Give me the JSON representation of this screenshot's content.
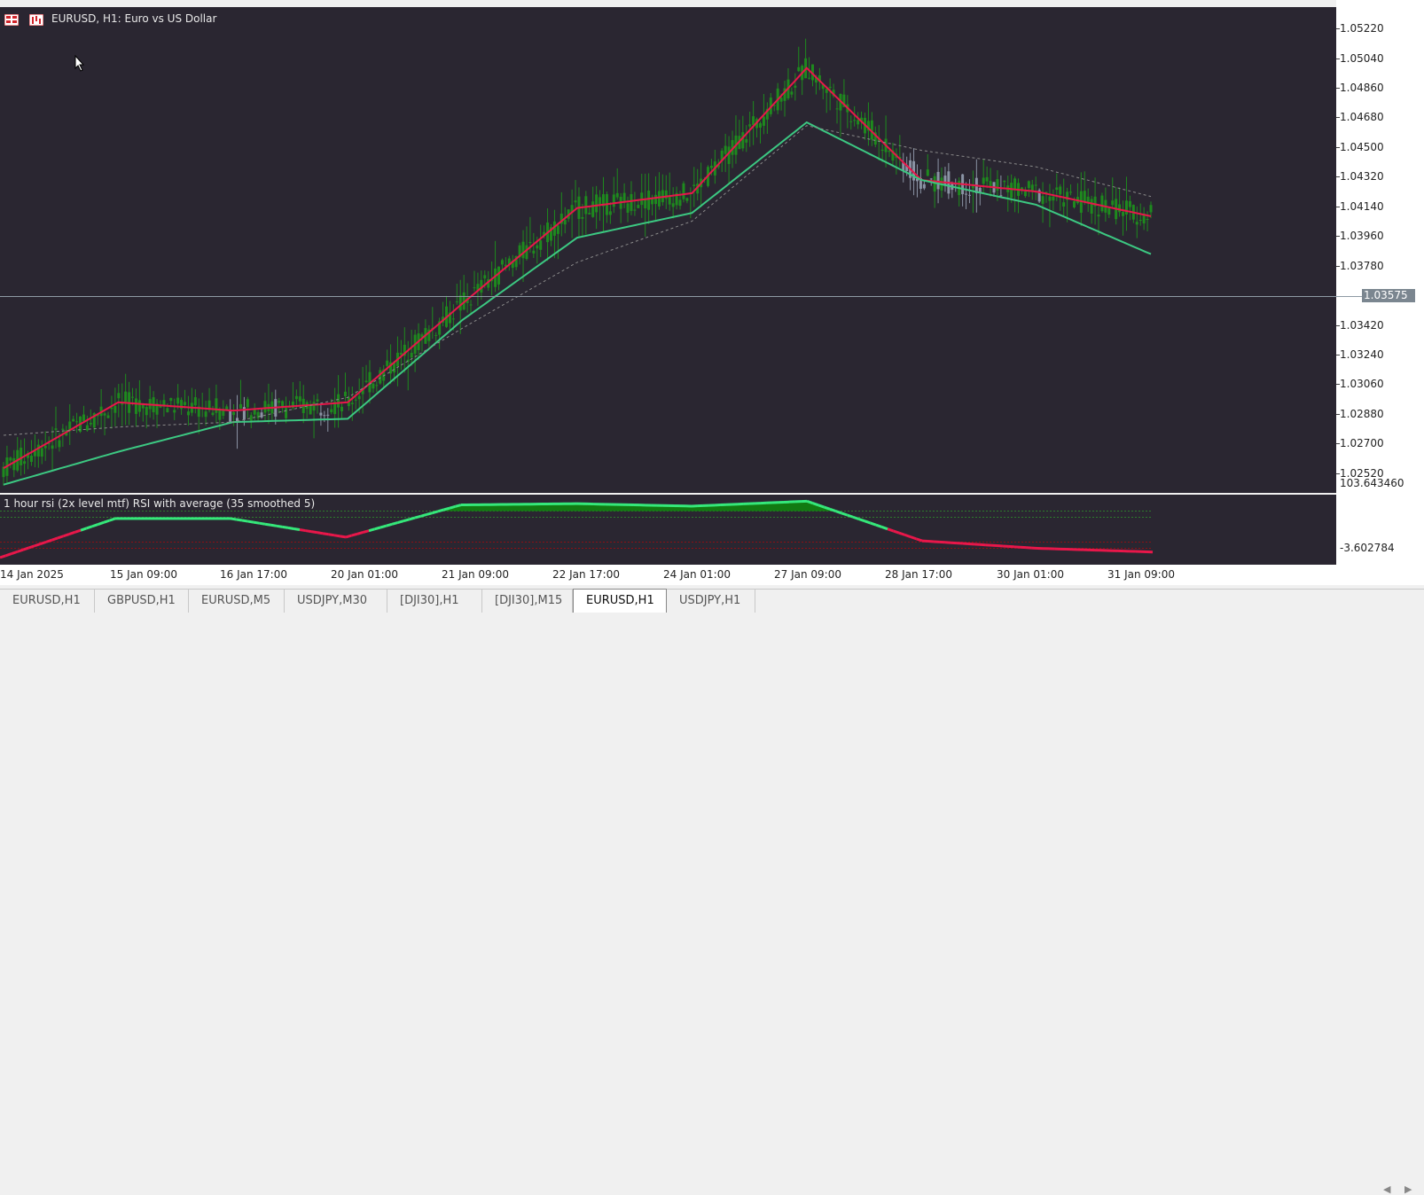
{
  "window": {
    "chart_title": "EURUSD, H1:  Euro vs US Dollar",
    "indicator_title": "1 hour rsi (2x level mtf) RSI with average (35 smoothed 5)"
  },
  "price_scale": {
    "ticks": [
      "1.05220",
      "1.05040",
      "1.04860",
      "1.04680",
      "1.04500",
      "1.04320",
      "1.04140",
      "1.03960",
      "1.03780",
      "1.03420",
      "1.03240",
      "1.03060",
      "1.02880",
      "1.02700",
      "1.02520"
    ],
    "current_price": "1.03575",
    "indicator_max": "103.643460",
    "indicator_min": "-3.602784"
  },
  "date_axis": {
    "labels": [
      "14 Jan 2025",
      "15 Jan 09:00",
      "16 Jan 17:00",
      "20 Jan 01:00",
      "21 Jan 09:00",
      "22 Jan 17:00",
      "24 Jan 01:00",
      "27 Jan 09:00",
      "28 Jan 17:00",
      "30 Jan 01:00",
      "31 Jan 09:00"
    ]
  },
  "tabs": [
    {
      "label": "EURUSD,H1",
      "active": false
    },
    {
      "label": "GBPUSD,H1",
      "active": false
    },
    {
      "label": "EURUSD,M5",
      "active": false
    },
    {
      "label": "USDJPY,M30",
      "active": false
    },
    {
      "label": "[DJI30],H1",
      "active": false
    },
    {
      "label": "[DJI30],M15",
      "active": false
    },
    {
      "label": "EURUSD,H1",
      "active": true
    },
    {
      "label": "USDJPY,H1",
      "active": false
    }
  ],
  "colors": {
    "background": "#2a2631",
    "bull": "#1e8a1e",
    "bear": "#8b1015",
    "neutral": "#8a93a4",
    "ma_fast": "#e8174a",
    "ma_slow": "#3cc882",
    "ma_dashed": "#8a8a8a",
    "rsi_up": "#35e87a",
    "rsi_down": "#e8174a"
  },
  "chart_data": {
    "type": "line",
    "symbol": "EURUSD",
    "timeframe": "H1",
    "ylim": [
      1.024,
      1.0535
    ],
    "x": [
      "14 Jan 2025",
      "15 Jan 09:00",
      "16 Jan 17:00",
      "20 Jan 01:00",
      "21 Jan 09:00",
      "22 Jan 17:00",
      "24 Jan 01:00",
      "27 Jan 09:00",
      "28 Jan 17:00",
      "30 Jan 01:00",
      "31 Jan 09:00"
    ],
    "series": [
      {
        "values": [
          1.0255,
          1.0295,
          1.029,
          1.0295,
          1.0355,
          1.0413,
          1.0422,
          1.0498,
          1.043,
          1.0423,
          1.0408
        ]
      },
      {
        "values": [
          1.0245,
          1.0265,
          1.0283,
          1.0285,
          1.0345,
          1.0395,
          1.041,
          1.0465,
          1.043,
          1.0415,
          1.0385
        ]
      },
      {
        "values": [
          1.0275,
          1.028,
          1.0283,
          1.0298,
          1.034,
          1.038,
          1.0405,
          1.0463,
          1.0448,
          1.0438,
          1.042
        ]
      }
    ],
    "current_price": 1.03575,
    "rsi": {
      "ylim": [
        -3.602784,
        103.64346
      ],
      "values": [
        5,
        68,
        68,
        38,
        90,
        92,
        88,
        96,
        32,
        20,
        14
      ],
      "levels": [
        80,
        70,
        30,
        20
      ]
    }
  }
}
